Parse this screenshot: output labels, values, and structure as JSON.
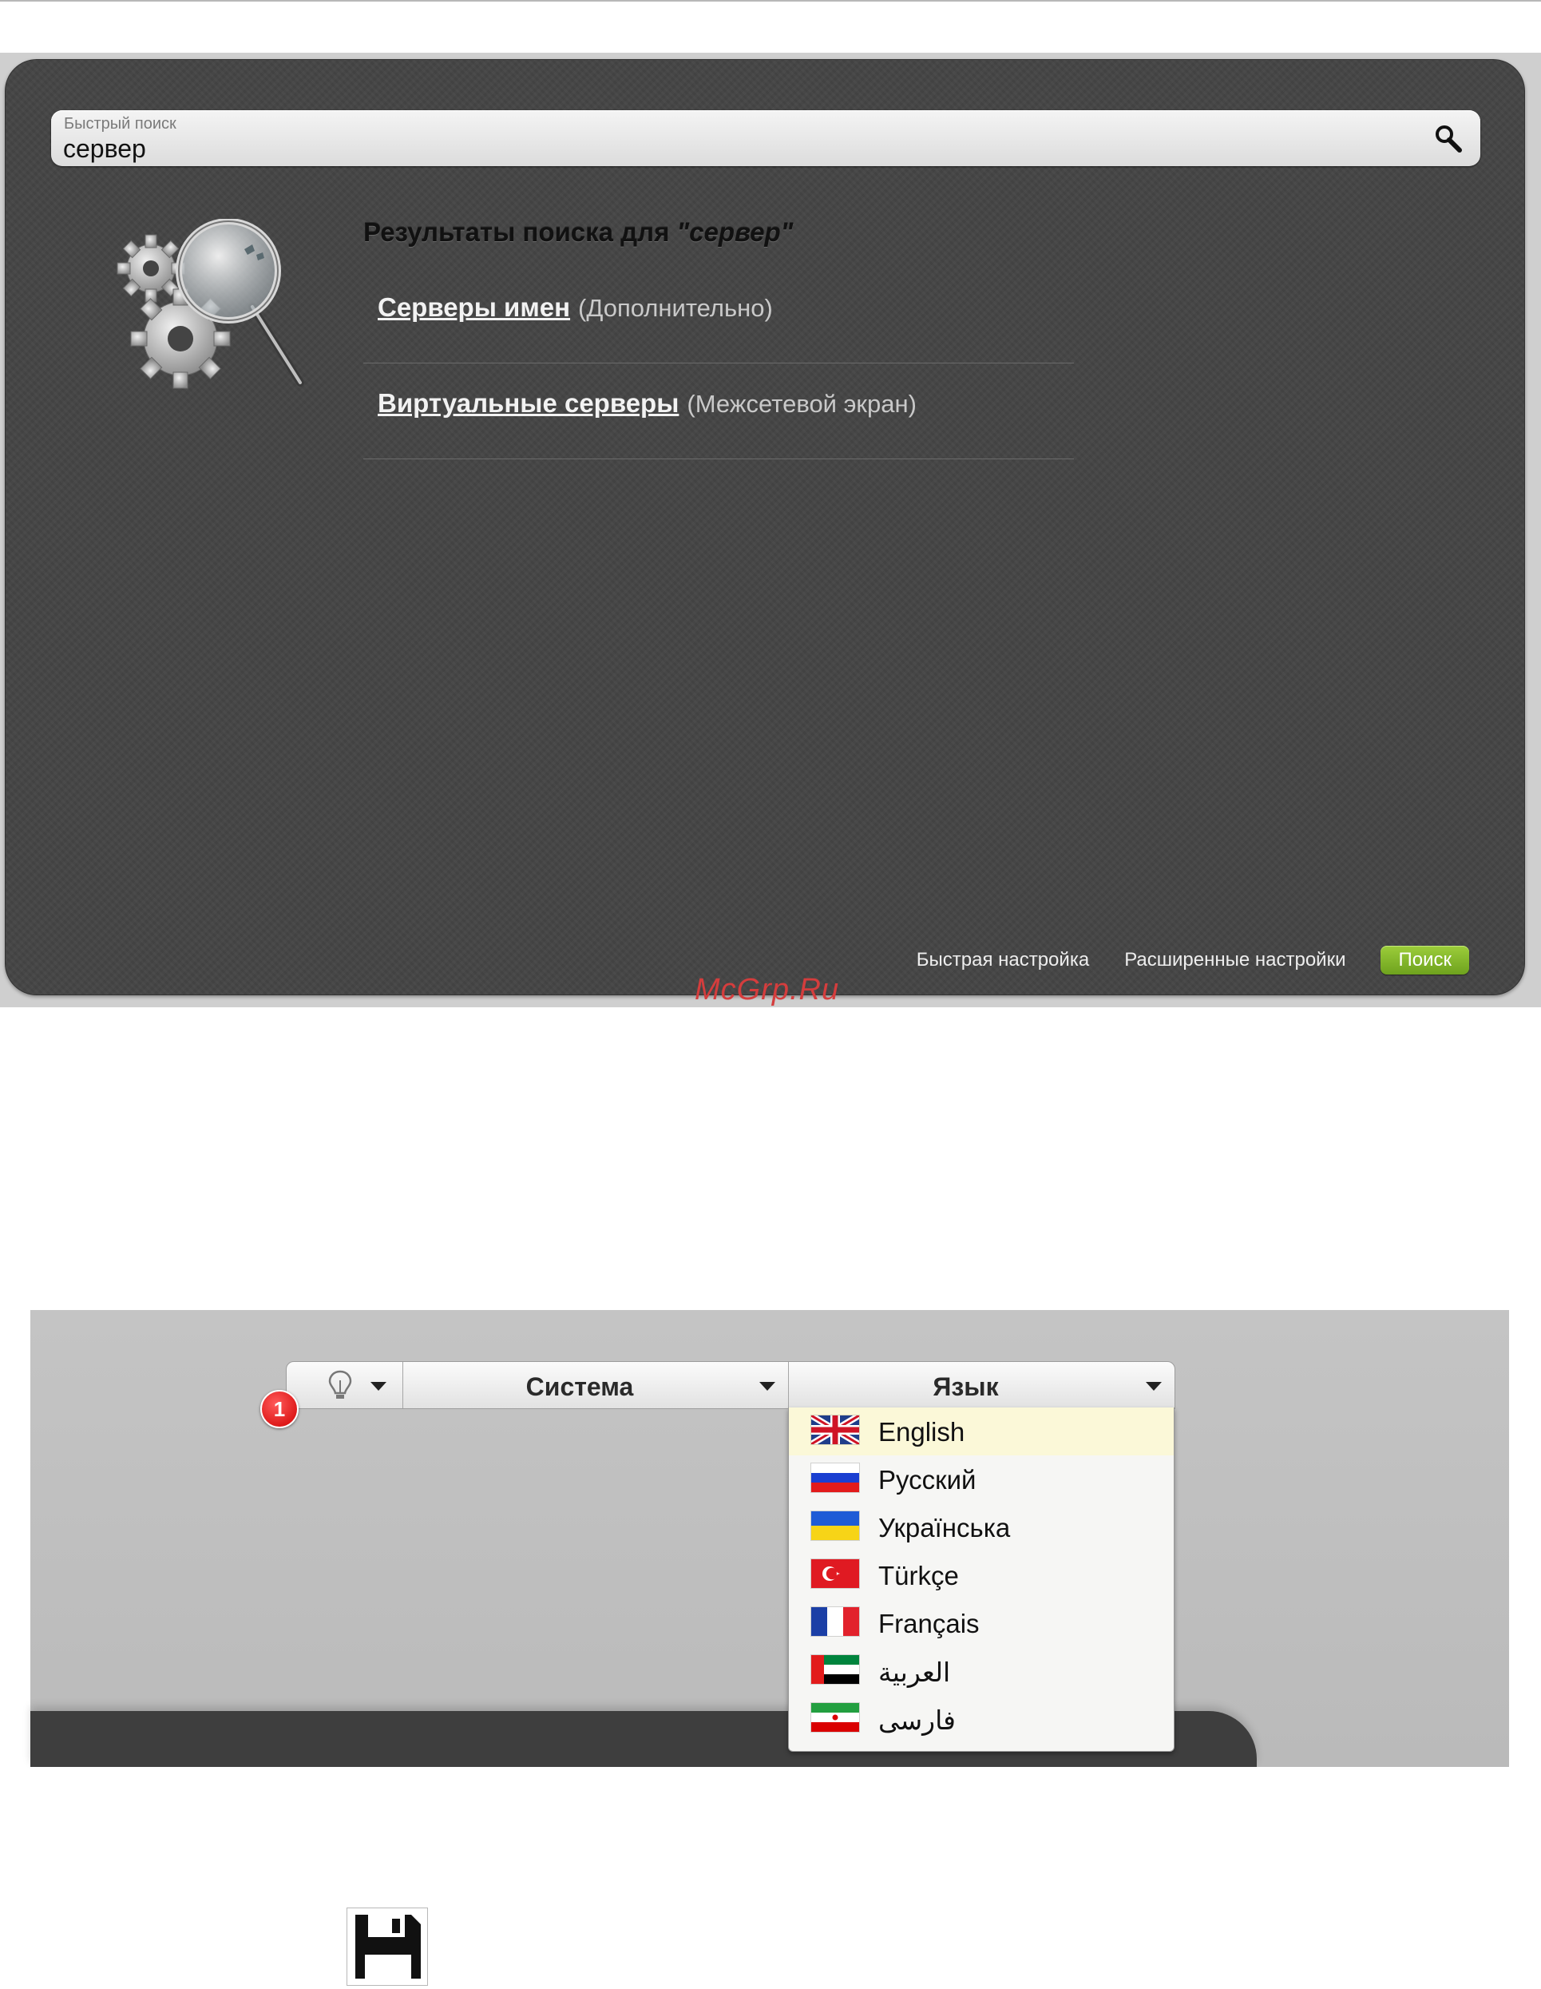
{
  "search": {
    "placeholder": "Быстрый поиск",
    "value": "сервер"
  },
  "results": {
    "title_prefix": "Результаты поиска для",
    "query": "\"сервер\"",
    "items": [
      {
        "link": "Серверы имен",
        "section": "(Дополнительно)"
      },
      {
        "link": "Виртуальные серверы",
        "section": "(Межсетевой экран)"
      }
    ]
  },
  "footer": {
    "quick_setup": "Быстрая настройка",
    "advanced": "Расширенные настройки",
    "search_button": "Поиск"
  },
  "watermark": "McGrp.Ru",
  "menubar": {
    "hint_icon": "lightbulb-icon",
    "system_label": "Система",
    "language_label": "Язык"
  },
  "badge": "1",
  "languages": [
    {
      "name": "English",
      "flag": "uk-flag-icon"
    },
    {
      "name": "Русский",
      "flag": "russia-flag-icon"
    },
    {
      "name": "Українська",
      "flag": "ukraine-flag-icon"
    },
    {
      "name": "Türkçe",
      "flag": "turkey-flag-icon"
    },
    {
      "name": "Français",
      "flag": "france-flag-icon"
    },
    {
      "name": "العربية",
      "flag": "uae-flag-icon"
    },
    {
      "name": "فارسی",
      "flag": "iran-flag-icon"
    }
  ],
  "colors": {
    "panel_bg": "#444444",
    "accent_green": "#8cc130",
    "badge_red": "#e00000",
    "selected_row": "#fbf8d8",
    "watermark_red": "#d43d3d"
  },
  "icons": {
    "search": "search-icon",
    "gears": "gears-magnifier-icon",
    "save": "floppy-disk-save-icon"
  }
}
